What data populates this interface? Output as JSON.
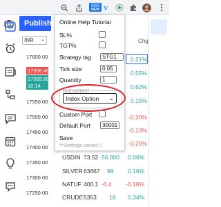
{
  "browser": {
    "new_badge": "NEW",
    "ext_letter": "v",
    "colors": {
      "toolbar": "#f1f3f4",
      "accent": "#1a73e8"
    }
  },
  "app": {
    "publish_label": "Publish",
    "symbol_select": "INR",
    "prices": [
      "17600.00",
      "17550.00",
      "17500.00",
      "17450.00",
      "17400.00",
      "17350.00",
      "17300.00",
      "17250.00"
    ],
    "price_tag_red": "17556.40",
    "price_tag_green": "17555.80",
    "price_tag_time": "10:14",
    "watch_header": "Chg%",
    "pct_values": [
      {
        "v": "0.21%",
        "cls": "up"
      },
      {
        "v": "0.55%",
        "cls": "up"
      },
      {
        "v": "0.62%",
        "cls": "up"
      },
      {
        "v": "0.15%",
        "cls": "up"
      },
      {
        "v": "-0.20%",
        "cls": "dn"
      },
      {
        "v": "-0.13%",
        "cls": "dn"
      },
      {
        "v": "-0.20%",
        "cls": "dn"
      }
    ],
    "watch_rows": [
      {
        "sym": "USDIN",
        "last": "73.52",
        "chg": "56.000",
        "pct": "0.06%",
        "color": "up"
      },
      {
        "sym": "SILVER",
        "last": "63667",
        "chg": "99",
        "pct": "0.16%",
        "color": "up"
      },
      {
        "sym": "NATUF",
        "last": "400.1",
        "chg": "-0.4",
        "pct": "-0.10%",
        "color": "dn"
      },
      {
        "sym": "CRUDE",
        "last": "5353",
        "chg": "18",
        "pct": "0.34%",
        "color": "up"
      }
    ],
    "colors": {
      "publish": "#2962ff",
      "up": "#26a69a",
      "down": "#ef5350"
    }
  },
  "popup": {
    "title": "Online Help Tutorial",
    "sl_label": "SL%",
    "tgt_label": "TGT%",
    "strategy_tag_label": "Strategy tag",
    "strategy_tag_value": "STG1",
    "tick_size_label": "Tick size",
    "tick_size_value": "0.05",
    "quantity_label": "Quantity",
    "quantity_value": "1",
    "instrument_legend": "Instrument",
    "instrument_value": "Index Option",
    "custom_port_label": "Custom Port",
    "default_port_label": "Default Port",
    "default_port_value": "30001",
    "save_label": "Save",
    "saved_msg": "**Settings saved.!!",
    "highlight_color": "#e01a22"
  }
}
